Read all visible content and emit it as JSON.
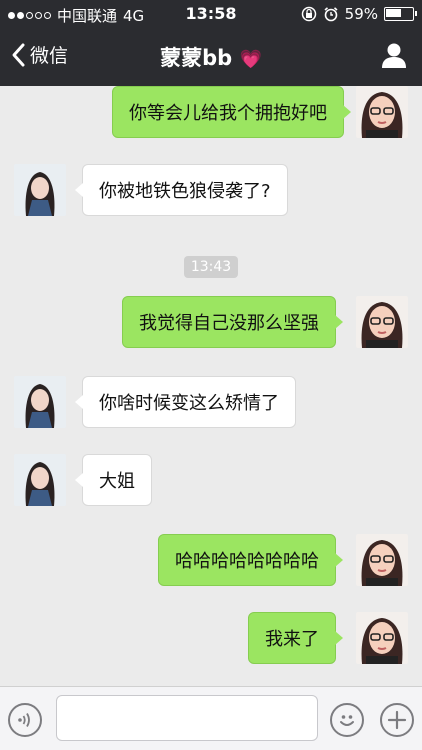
{
  "status_bar": {
    "carrier": "中国联通",
    "network": "4G",
    "time": "13:58",
    "battery": "59%",
    "battery_fraction": 0.59
  },
  "nav": {
    "back_label": "微信",
    "title": "蒙蒙bb",
    "title_emoji": "💗"
  },
  "messages": [
    {
      "side": "out",
      "text": "你等会儿给我个拥抱好吧"
    },
    {
      "side": "in",
      "text": "你被地铁色狼侵袭了?"
    },
    {
      "side": "out",
      "text": "我觉得自己没那么坚强"
    },
    {
      "side": "in",
      "text": "你啥时候变这么矫情了"
    },
    {
      "side": "in",
      "text": "大姐"
    },
    {
      "side": "out",
      "text": "哈哈哈哈哈哈哈哈"
    },
    {
      "side": "out",
      "text": "我来了"
    }
  ],
  "timestamp": "13:43",
  "input": {
    "value": "",
    "placeholder": ""
  },
  "icons": {
    "back": "chevron-left-icon",
    "profile": "person-icon",
    "voice": "voice-icon",
    "emoji": "emoji-icon",
    "plus": "plus-icon",
    "lock": "orientation-lock-icon",
    "alarm": "alarm-icon"
  },
  "colors": {
    "header": "#2b2c30",
    "outgoing_bubble": "#9be561",
    "incoming_bubble": "#ffffff",
    "chat_bg": "#ebebeb"
  }
}
